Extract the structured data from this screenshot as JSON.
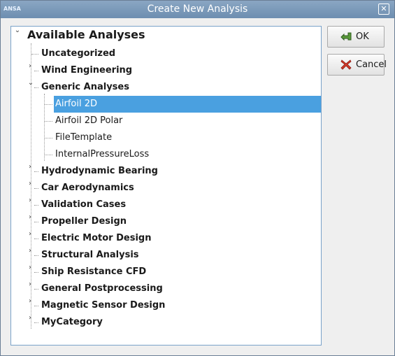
{
  "window": {
    "title": "Create New Analysis",
    "app_icon": "ANSA"
  },
  "tree": {
    "root": "Available Analyses",
    "categories": [
      {
        "label": "Uncategorized"
      },
      {
        "label": "Wind Engineering"
      },
      {
        "label": "Generic Analyses"
      },
      {
        "label": "Hydrodynamic Bearing"
      },
      {
        "label": "Car Aerodynamics"
      },
      {
        "label": "Validation Cases"
      },
      {
        "label": "Propeller Design"
      },
      {
        "label": "Electric Motor Design"
      },
      {
        "label": "Structural Analysis"
      },
      {
        "label": "Ship Resistance CFD"
      },
      {
        "label": "General Postprocessing"
      },
      {
        "label": "Magnetic Sensor Design"
      },
      {
        "label": "MyCategory"
      }
    ],
    "generic_children": [
      {
        "label": "Airfoil 2D",
        "selected": true
      },
      {
        "label": "Airfoil 2D Polar"
      },
      {
        "label": "FileTemplate"
      },
      {
        "label": "InternalPressureLoss"
      }
    ],
    "selection_color": "#4aa0e0"
  },
  "buttons": {
    "ok_label": "OK",
    "cancel_label": "Cancel"
  }
}
